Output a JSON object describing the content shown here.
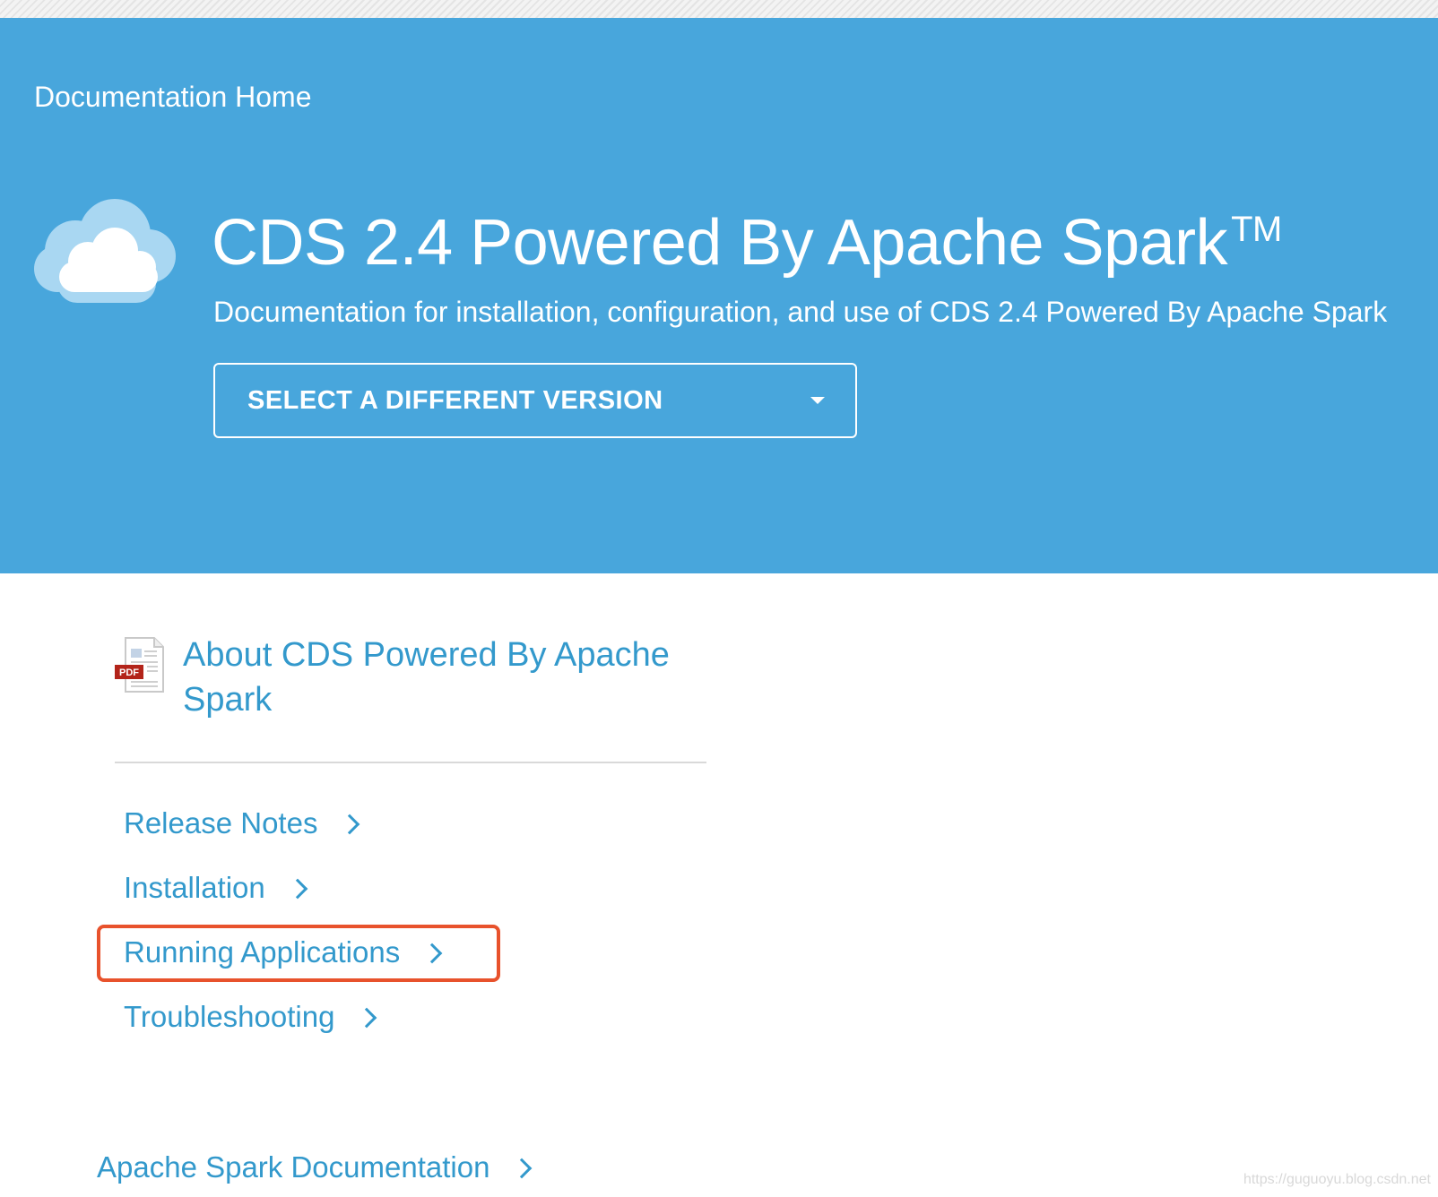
{
  "header": {
    "documentation_home": "Documentation Home",
    "title": "CDS 2.4 Powered By Apache Spark",
    "title_trademark": "TM",
    "subtitle": "Documentation for installation, configuration, and use of CDS 2.4 Powered By Apache Spark",
    "version_select_label": "SELECT A DIFFERENT VERSION"
  },
  "about": {
    "title": "About CDS Powered By Apache Spark",
    "pdf_badge": "PDF"
  },
  "nav": {
    "items": [
      {
        "label": "Release Notes"
      },
      {
        "label": "Installation"
      },
      {
        "label": "Running Applications",
        "highlighted": true
      },
      {
        "label": "Troubleshooting"
      }
    ]
  },
  "footer": {
    "apache_spark_docs": "Apache Spark Documentation",
    "watermark": "https://guguoyu.blog.csdn.net"
  },
  "colors": {
    "hero_background": "#48a6dc",
    "link": "#3399cc",
    "highlight": "#e8522c"
  },
  "icons": {
    "logo": "cloud-icon",
    "about": "pdf-icon",
    "select": "caret-down-icon",
    "nav": "chevron-right-icon"
  }
}
